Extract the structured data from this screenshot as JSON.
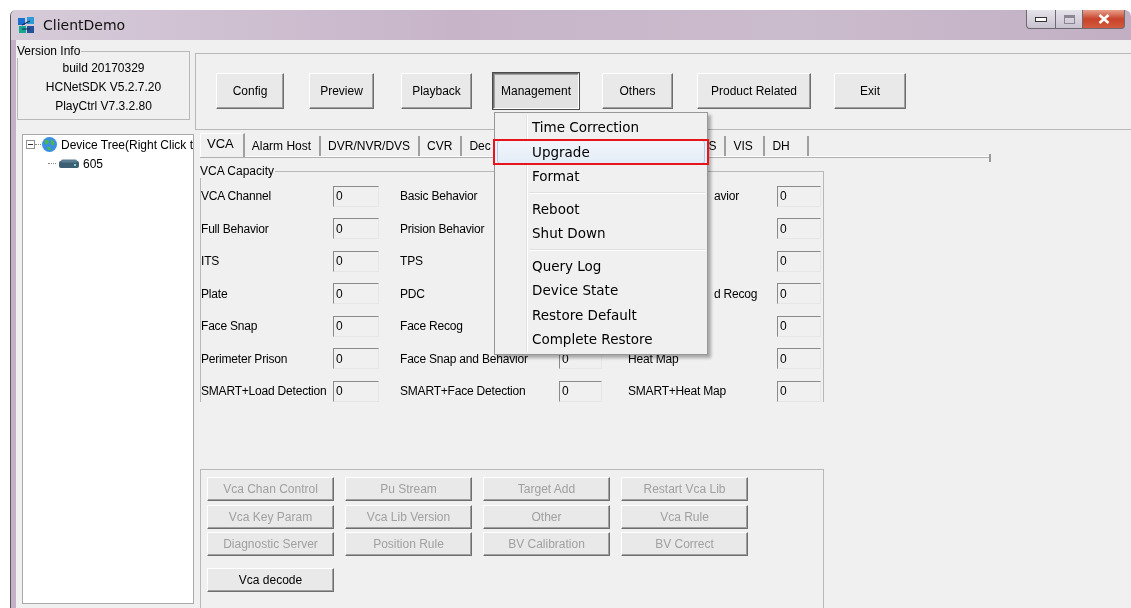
{
  "window": {
    "title": "ClientDemo"
  },
  "version_info": {
    "title": "Version Info",
    "lines": [
      "build 20170329",
      "HCNetSDK V5.2.7.20",
      "PlayCtrl V7.3.2.80"
    ]
  },
  "toolbar": [
    {
      "label": "Config",
      "pressed": false
    },
    {
      "label": "Preview",
      "pressed": false
    },
    {
      "label": "Playback",
      "pressed": false
    },
    {
      "label": "Management",
      "pressed": true
    },
    {
      "label": "Others",
      "pressed": false
    },
    {
      "label": "Product Related",
      "pressed": false
    },
    {
      "label": "Exit",
      "pressed": false
    }
  ],
  "device_tree": {
    "label": "Device Tree(Right Click t",
    "expanded": true,
    "children": [
      {
        "label": "605"
      }
    ]
  },
  "tabs": [
    {
      "label": "VCA",
      "selected": true
    },
    {
      "label": "Alarm Host",
      "selected": false
    },
    {
      "label": "DVR/NVR/DVS",
      "selected": false
    },
    {
      "label": "CVR",
      "selected": false
    },
    {
      "label": "Dec",
      "selected": false
    },
    {
      "label": "S",
      "selected": false
    },
    {
      "label": "VIS",
      "selected": false
    },
    {
      "label": "DH",
      "selected": false
    }
  ],
  "vca_capacity": {
    "title": "VCA Capacity",
    "rows": [
      [
        {
          "label": "VCA Channel",
          "value": "0"
        },
        {
          "label": "Basic Behavior"
        },
        {
          "label": "avior",
          "value": "0"
        }
      ],
      [
        {
          "label": "Full Behavior",
          "value": "0"
        },
        {
          "label": "Prision Behavior"
        },
        {
          "value": "0"
        }
      ],
      [
        {
          "label": "ITS",
          "value": "0"
        },
        {
          "label": "TPS"
        },
        {
          "value": "0"
        }
      ],
      [
        {
          "label": "Plate",
          "value": "0"
        },
        {
          "label": "PDC"
        },
        {
          "label": "d Recog",
          "value": "0"
        }
      ],
      [
        {
          "label": "Face Snap",
          "value": "0"
        },
        {
          "label": "Face Recog"
        },
        {
          "value": "0"
        }
      ],
      [
        {
          "label": "Perimeter Prison",
          "value": "0"
        },
        {
          "label": "Face Snap and Behavior",
          "value": "0"
        },
        {
          "label": "Heat Map",
          "value": "0"
        }
      ],
      [
        {
          "label": "SMART+Load Detection",
          "value": "0"
        },
        {
          "label": "SMART+Face Detection",
          "value": "0"
        },
        {
          "label": "SMART+Heat Map",
          "value": "0"
        }
      ]
    ]
  },
  "vca_buttons": [
    {
      "label": "Vca Chan Control",
      "disabled": true
    },
    {
      "label": "Pu Stream",
      "disabled": true
    },
    {
      "label": "Target Add",
      "disabled": true
    },
    {
      "label": "Restart Vca Lib",
      "disabled": true
    },
    {
      "label": "Vca Key Param",
      "disabled": true
    },
    {
      "label": "Vca Lib Version",
      "disabled": true
    },
    {
      "label": "Other",
      "disabled": true
    },
    {
      "label": "Vca Rule",
      "disabled": true
    },
    {
      "label": "Diagnostic Server",
      "disabled": true
    },
    {
      "label": "Position Rule",
      "disabled": true
    },
    {
      "label": "BV Calibration",
      "disabled": true
    },
    {
      "label": "BV Correct",
      "disabled": true
    },
    {
      "label": "Vca decode",
      "disabled": false
    }
  ],
  "management_menu": [
    {
      "kind": "item",
      "label": "Time Correction",
      "selected": false,
      "marked": false
    },
    {
      "kind": "item",
      "label": "Upgrade",
      "selected": true,
      "marked": true
    },
    {
      "kind": "item",
      "label": "Format",
      "selected": false,
      "marked": false
    },
    {
      "kind": "separator"
    },
    {
      "kind": "item",
      "label": "Reboot",
      "selected": false,
      "marked": false
    },
    {
      "kind": "item",
      "label": "Shut Down",
      "selected": false,
      "marked": false
    },
    {
      "kind": "separator"
    },
    {
      "kind": "item",
      "label": "Query Log",
      "selected": false,
      "marked": false
    },
    {
      "kind": "item",
      "label": "Device State",
      "selected": false,
      "marked": false
    },
    {
      "kind": "item",
      "label": "Restore Default",
      "selected": false,
      "marked": false
    },
    {
      "kind": "item",
      "label": "Complete Restore",
      "selected": false,
      "marked": false
    }
  ]
}
